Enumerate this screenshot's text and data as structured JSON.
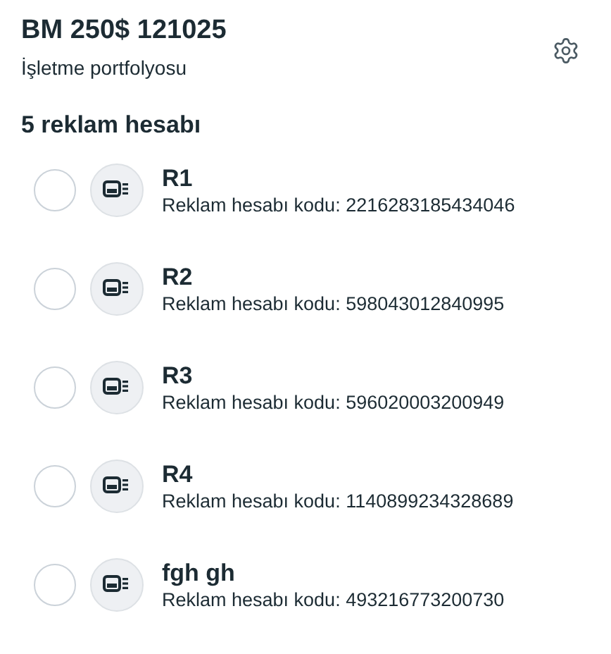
{
  "header": {
    "title": "BM 250$ 121025",
    "subtitle": "İşletme portfolyosu"
  },
  "section_title": "5 reklam hesabı",
  "accounts": [
    {
      "name": "R1",
      "code": "Reklam hesabı kodu: 2216283185434046",
      "selected": false
    },
    {
      "name": "R2",
      "code": "Reklam hesabı kodu: 598043012840995",
      "selected": false
    },
    {
      "name": "R3",
      "code": "Reklam hesabı kodu: 596020003200949",
      "selected": false
    },
    {
      "name": "R4",
      "code": "Reklam hesabı kodu: 1140899234328689",
      "selected": false
    },
    {
      "name": "fgh gh",
      "code": "Reklam hesabı kodu: 493216773200730",
      "selected": false
    }
  ]
}
